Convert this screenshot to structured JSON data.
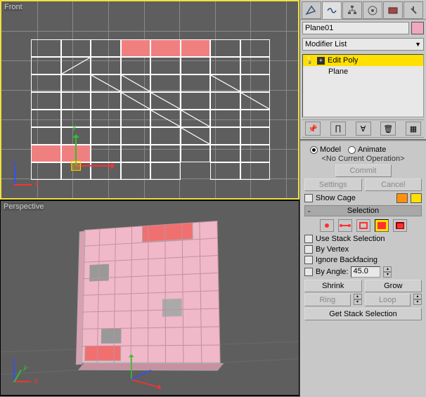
{
  "viewports": {
    "front_label": "Front",
    "perspective_label": "Perspective"
  },
  "object": {
    "name": "Plane01",
    "color": "#f0a8c0"
  },
  "modifier_dropdown": "Modifier List",
  "stack": {
    "items": [
      {
        "label": "Edit Poly",
        "selected": true,
        "expandable": true
      },
      {
        "label": "Plane",
        "selected": false,
        "expandable": false
      }
    ]
  },
  "edit_mode": {
    "model": "Model",
    "animate": "Animate",
    "selected": "model",
    "no_op": "<No Current Operation>",
    "commit": "Commit",
    "settings": "Settings",
    "cancel": "Cancel",
    "show_cage": "Show Cage"
  },
  "selection": {
    "header": "Selection",
    "use_stack": "Use Stack Selection",
    "by_vertex": "By Vertex",
    "ignore_backfacing": "Ignore Backfacing",
    "by_angle": "By Angle:",
    "angle_value": "45.0",
    "shrink": "Shrink",
    "grow": "Grow",
    "ring": "Ring",
    "loop": "Loop",
    "get_stack": "Get Stack Selection",
    "active_mode": "polygon"
  },
  "colors": {
    "accent_orange": "#ff9010",
    "accent_yellow": "#ffe000",
    "selected_face": "#f07070"
  }
}
